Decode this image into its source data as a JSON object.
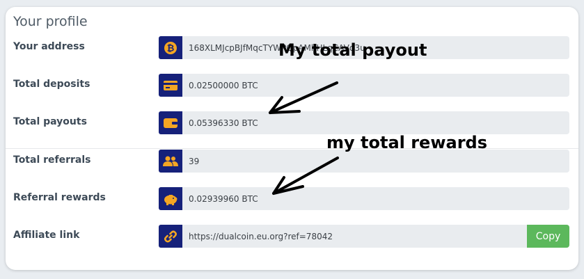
{
  "profile": {
    "title": "Your profile",
    "rows": [
      {
        "label": "Your address",
        "value": "168XLMJcpBJfMqcTYWPQpAMhHLqCAVd3u",
        "icon": "bitcoin-icon"
      },
      {
        "label": "Total deposits",
        "value": "0.02500000 BTC",
        "icon": "card-icon"
      },
      {
        "label": "Total payouts",
        "value": "0.05396330 BTC",
        "icon": "wallet-icon"
      },
      {
        "label": "Total referrals",
        "value": "39",
        "icon": "users-icon"
      },
      {
        "label": "Referral rewards",
        "value": "0.02939960 BTC",
        "icon": "piggy-bank-icon"
      },
      {
        "label": "Affiliate link",
        "value": "https://dualcoin.eu.org?ref=78042",
        "icon": "link-icon"
      }
    ],
    "copy_label": "Copy"
  },
  "annotations": {
    "payout": "My total payout",
    "rewards": "my total rewards"
  },
  "colors": {
    "icon_bg": "#16217a",
    "icon_fg": "#f5a623",
    "copy_bg": "#5cb85c"
  }
}
